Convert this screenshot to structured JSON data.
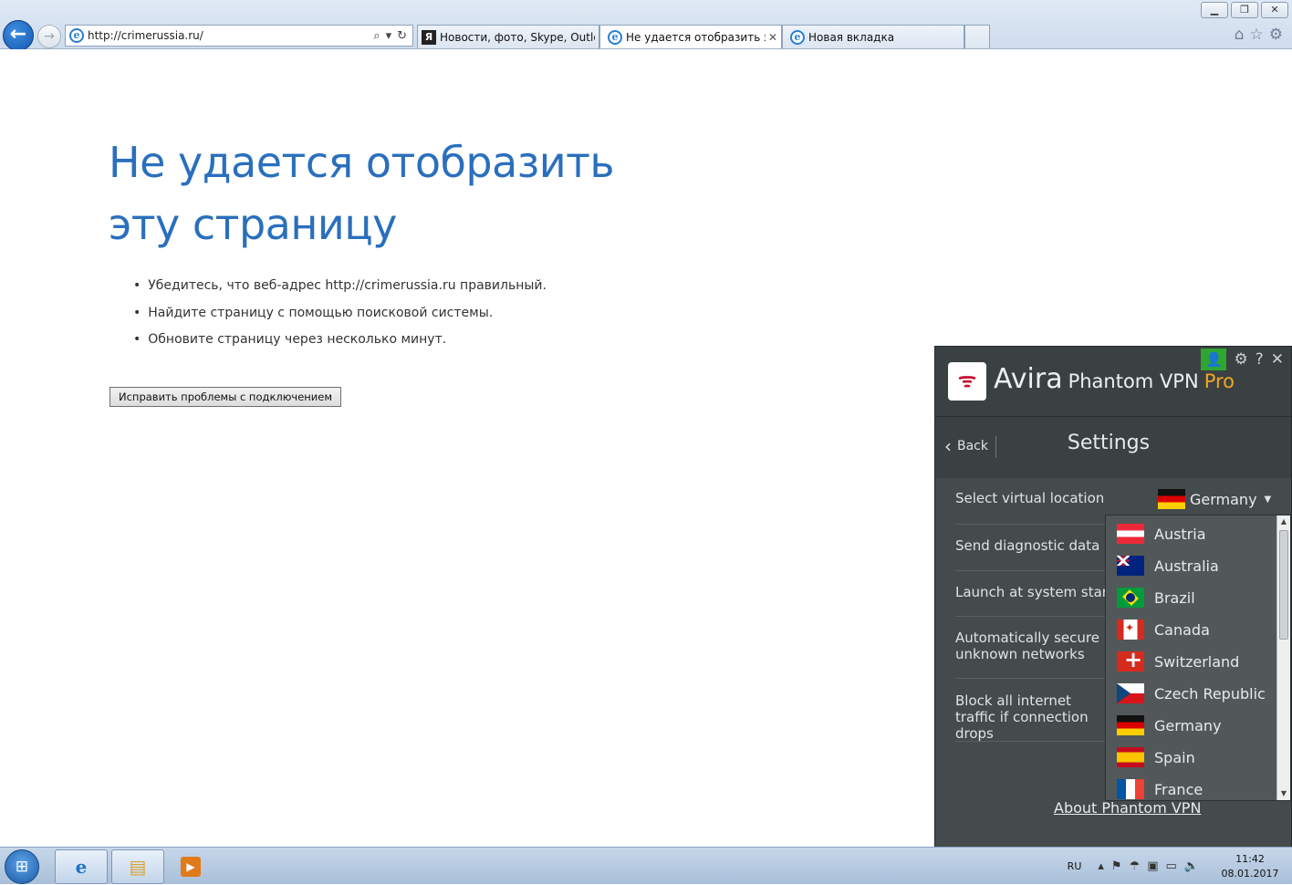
{
  "browser": {
    "address": "http://crimerussia.ru/",
    "tabs": [
      {
        "label": "Новости, фото, Skype, Outloo...",
        "icon": "yandex-icon",
        "active": false
      },
      {
        "label": "Не удается отобразить эту...",
        "icon": "ie-page-icon",
        "active": true
      },
      {
        "label": "Новая вкладка",
        "icon": "ie-page-icon",
        "active": false
      }
    ]
  },
  "error_page": {
    "title": "Не удается отобразить эту страницу",
    "bullets": [
      "Убедитесь, что веб-адрес http://crimerussia.ru правильный.",
      "Найдите страницу с помощью поисковой системы.",
      "Обновите страницу через несколько минут."
    ],
    "fix_button": "Исправить проблемы с подключением"
  },
  "vpn": {
    "brand_main": "Avira",
    "brand_sub": "Phantom VPN",
    "brand_pro": "Pro",
    "back_label": "Back",
    "title": "Settings",
    "rows": {
      "location": "Select virtual location",
      "diagnostic": "Send diagnostic data",
      "launch": "Launch at system start",
      "auto_secure": "Automatically secure unknown networks",
      "block_traffic": "Block all internet traffic if connection drops"
    },
    "selected_location": "Germany",
    "locations": [
      "Austria",
      "Australia",
      "Brazil",
      "Canada",
      "Switzerland",
      "Czech Republic",
      "Germany",
      "Spain",
      "France"
    ],
    "about_link": "About Phantom VPN",
    "accent_color": "#f0a720",
    "user_badge_color": "#2fa62f"
  },
  "taskbar": {
    "language": "RU",
    "time": "11:42",
    "date": "08.01.2017"
  }
}
